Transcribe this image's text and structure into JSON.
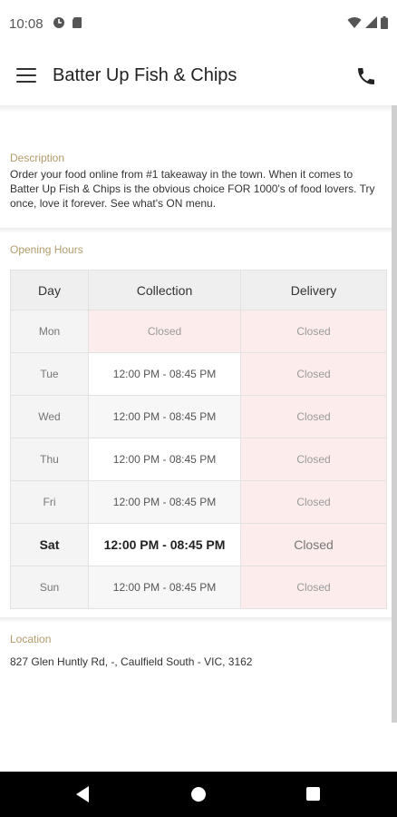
{
  "status": {
    "time": "10:08"
  },
  "app_bar": {
    "title": "Batter Up Fish & Chips"
  },
  "description": {
    "label": "Description",
    "text": "Order your food online from #1 takeaway in the town. When it comes to Batter Up Fish & Chips is the obvious choice FOR 1000's of food lovers. Try once, love it forever. See what's ON menu."
  },
  "hours": {
    "label": "Opening Hours",
    "headers": {
      "day": "Day",
      "collection": "Collection",
      "delivery": "Delivery"
    },
    "rows": [
      {
        "day": "Mon",
        "collection": "Closed",
        "delivery": "Closed"
      },
      {
        "day": "Tue",
        "collection": "12:00 PM - 08:45 PM",
        "delivery": "Closed"
      },
      {
        "day": "Wed",
        "collection": "12:00 PM - 08:45 PM",
        "delivery": "Closed"
      },
      {
        "day": "Thu",
        "collection": "12:00 PM - 08:45 PM",
        "delivery": "Closed"
      },
      {
        "day": "Fri",
        "collection": "12:00 PM - 08:45 PM",
        "delivery": "Closed"
      },
      {
        "day": "Sat",
        "collection": "12:00 PM - 08:45 PM",
        "delivery": "Closed"
      },
      {
        "day": "Sun",
        "collection": "12:00 PM - 08:45 PM",
        "delivery": "Closed"
      }
    ]
  },
  "location": {
    "label": "Location",
    "address": "827 Glen Huntly Rd, -, Caulfield South - VIC, 3162"
  },
  "colors": {
    "section_label": "#b29b6b",
    "closed_bg": "#fdecec"
  },
  "icons": [
    "menu-icon",
    "phone-icon",
    "wifi-icon",
    "signal-icon",
    "battery-icon",
    "back-icon",
    "home-icon",
    "recent-apps-icon"
  ]
}
